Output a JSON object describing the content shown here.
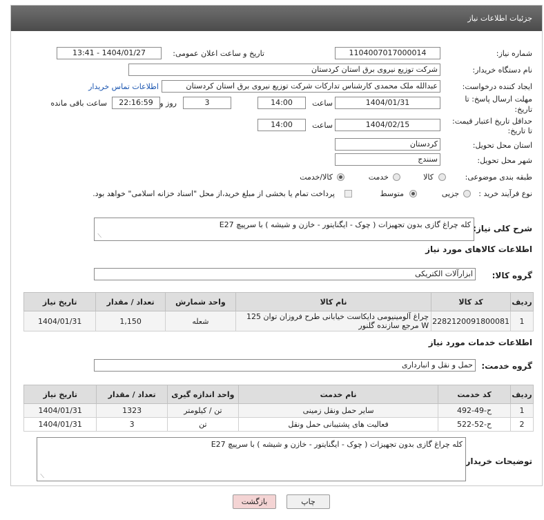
{
  "header": {
    "title": "جزئیات اطلاعات نیاز"
  },
  "form": {
    "need_no_label": "شماره نیاز:",
    "need_no": "1104007017000014",
    "announce_label": "تاریخ و ساعت اعلان عمومی:",
    "announce_value": "1404/01/27 - 13:41",
    "buyer_label": "نام دستگاه خریدار:",
    "buyer_value": "شرکت توزیع نیروی برق استان کردستان",
    "creator_label": "ایجاد کننده درخواست:",
    "creator_value": "عبدالله ملک محمدی کارشناس تدارکات شرکت توزیع نیروی برق استان کردستان",
    "contact_link": "اطلاعات تماس خریدار",
    "deadline_label_1": "مهلت ارسال پاسخ: تا",
    "deadline_label_2": "تاریخ:",
    "deadline_date": "1404/01/31",
    "time_label": "ساعت",
    "deadline_time": "14:00",
    "days_value": "3",
    "days_label": "روز و",
    "remaining_time": "22:16:59",
    "remaining_label": "ساعت باقی مانده",
    "validity_label_1": "حداقل تاریخ اعتبار قیمت:",
    "validity_label_2": "تا تاریخ:",
    "validity_date": "1404/02/15",
    "validity_time": "14:00",
    "province_label": "استان محل تحویل:",
    "province_value": "کردستان",
    "city_label": "شهر محل تحویل:",
    "city_value": "سنندج",
    "category_label": "طبقه بندی موضوعی:",
    "category_options": [
      "کالا",
      "خدمت",
      "کالا/خدمت"
    ],
    "category_selected": "کالا/خدمت",
    "process_label": "نوع فرآیند خرید :",
    "process_options": [
      "جزیی",
      "متوسط"
    ],
    "process_selected": "متوسط",
    "payment_note": "پرداخت تمام یا بخشی از مبلغ خرید،از محل \"اسناد خزانه اسلامی\" خواهد بود."
  },
  "description": {
    "label": "شرح کلی نیاز:",
    "value": "کله چراغ گازی بدون تجهیزات ( چوک - ایگنایتور - خازن و شیشه ) با سرپیچ E27"
  },
  "goods": {
    "section_title": "اطلاعات کالاهای مورد نیاز",
    "group_label": "گروه کالا:",
    "group_value": "ابزارآلات الکتریکی",
    "columns": [
      "ردیف",
      "کد کالا",
      "نام کالا",
      "واحد شمارش",
      "تعداد / مقدار",
      "تاریخ نیاز"
    ],
    "rows": [
      [
        "1",
        "2282120091800081",
        "چراغ آلومینیومی دایکاست خیابانی طرح فروزان توان 125 W مرجع سازنده گلنور",
        "شعله",
        "1,150",
        "1404/01/31"
      ]
    ]
  },
  "services": {
    "section_title": "اطلاعات خدمات مورد نیاز",
    "group_label": "گروه خدمت:",
    "group_value": "حمل و نقل و انبارداری",
    "columns": [
      "ردیف",
      "کد خدمت",
      "نام خدمت",
      "واحد اندازه گیری",
      "تعداد / مقدار",
      "تاریخ نیاز"
    ],
    "rows": [
      [
        "1",
        "ح-49-492",
        "سایر حمل ونقل زمینی",
        "تن / کیلومتر",
        "1323",
        "1404/01/31"
      ],
      [
        "2",
        "ح-52-522",
        "فعالیت های پشتیبانی حمل ونقل",
        "تن",
        "3",
        "1404/01/31"
      ]
    ]
  },
  "buyer_notes": {
    "label": "توضیحات خریدار:",
    "value": "کله چراغ گازی بدون تجهیزات ( چوک - ایگنایتور - خازن و شیشه ) با سرپیچ E27"
  },
  "buttons": {
    "print": "چاپ",
    "back": "بازگشت"
  },
  "colors": {
    "header_bg": "#555555",
    "link": "#1a55b0",
    "back_btn": "#f4d4d4",
    "print_btn": "#f0f0f0"
  }
}
